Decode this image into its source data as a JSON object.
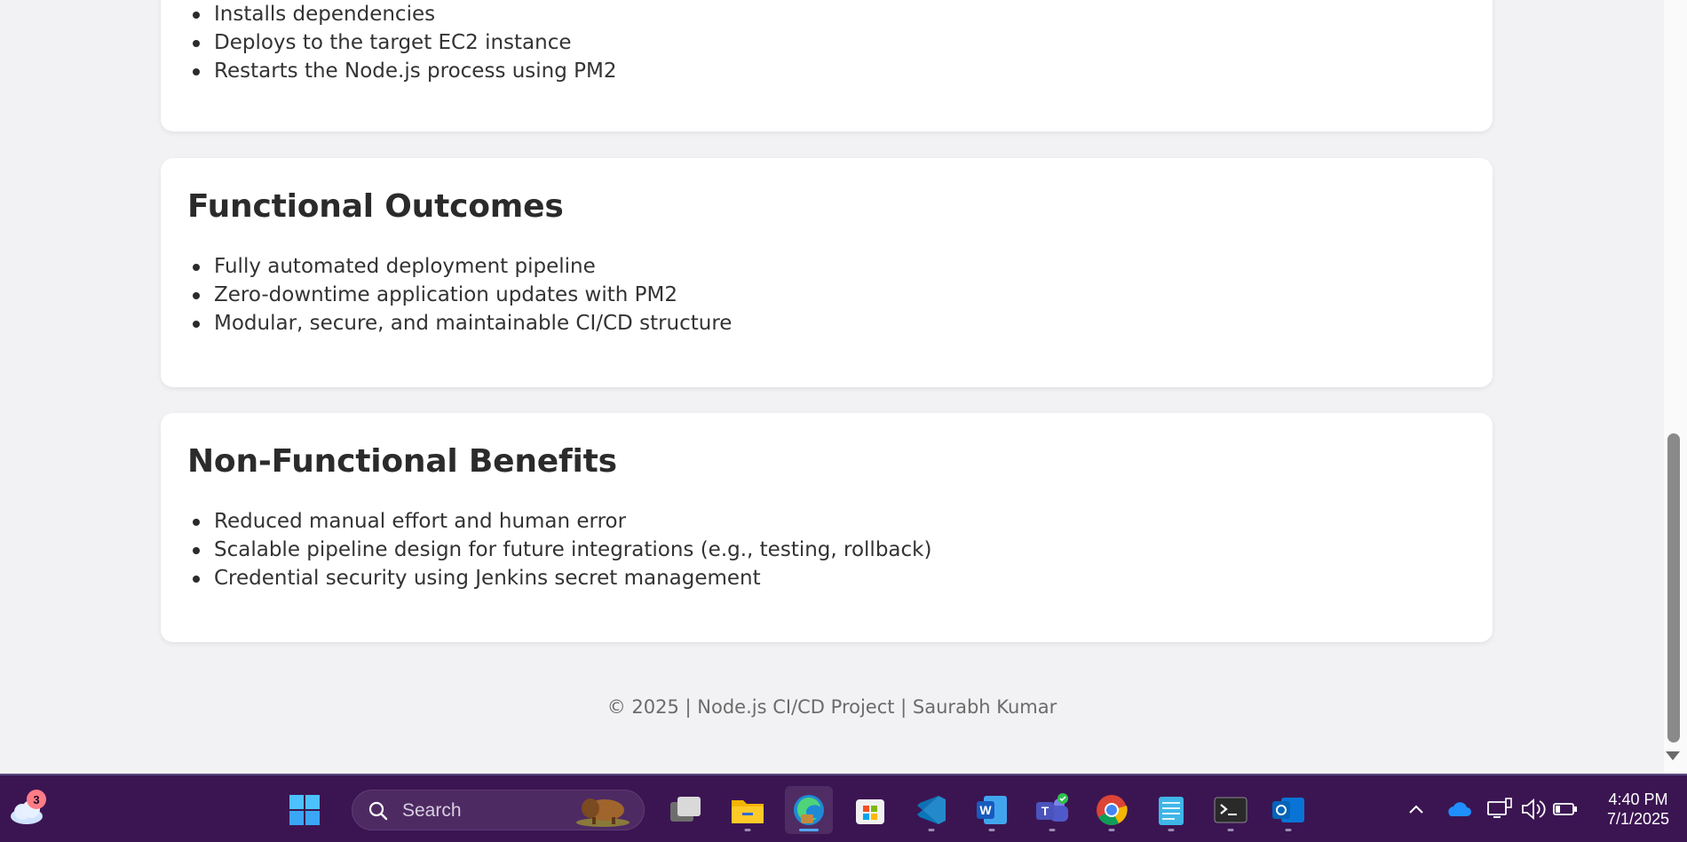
{
  "page": {
    "top_card": {
      "items": [
        "Installs dependencies",
        "Deploys to the target EC2 instance",
        "Restarts the Node.js process using PM2"
      ]
    },
    "functional": {
      "title": "Functional Outcomes",
      "items": [
        "Fully automated deployment pipeline",
        "Zero-downtime application updates with PM2",
        "Modular, secure, and maintainable CI/CD structure"
      ]
    },
    "nonfunctional": {
      "title": "Non-Functional Benefits",
      "items": [
        "Reduced manual effort and human error",
        "Scalable pipeline design for future integrations (e.g., testing, rollback)",
        "Credential security using Jenkins secret management"
      ]
    },
    "footer": "© 2025 | Node.js CI/CD Project | Saurabh Kumar"
  },
  "taskbar": {
    "weather_badge": "3",
    "search_placeholder": "Search",
    "apps": [
      {
        "name": "start",
        "icon": "windows-start-icon"
      },
      {
        "name": "task-view",
        "icon": "task-view-icon"
      },
      {
        "name": "file-explorer",
        "icon": "folder-icon"
      },
      {
        "name": "edge",
        "icon": "edge-browser-icon",
        "active": true
      },
      {
        "name": "store",
        "icon": "microsoft-store-icon"
      },
      {
        "name": "vscode",
        "icon": "vscode-icon"
      },
      {
        "name": "word",
        "icon": "word-icon"
      },
      {
        "name": "teams",
        "icon": "teams-icon"
      },
      {
        "name": "chrome",
        "icon": "chrome-icon"
      },
      {
        "name": "notepad",
        "icon": "notepad-icon"
      },
      {
        "name": "terminal",
        "icon": "terminal-icon"
      },
      {
        "name": "outlook",
        "icon": "outlook-icon"
      }
    ],
    "clock": {
      "time": "4:40 PM",
      "date": "7/1/2025"
    }
  },
  "colors": {
    "taskbar_bg": "#3b1552",
    "page_bg": "#f2f2f4",
    "card_bg": "#ffffff",
    "accent": "#4fa8ff"
  }
}
